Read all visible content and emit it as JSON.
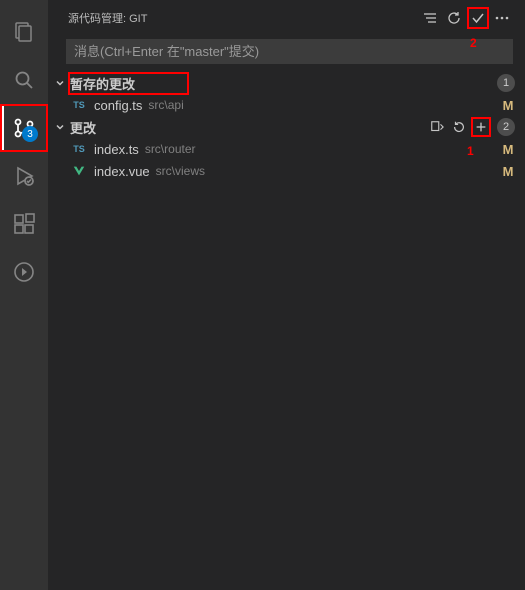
{
  "activityBar": {
    "scmBadge": "3"
  },
  "panel": {
    "title": "源代码管理: GIT",
    "messagePlaceholder": "消息(Ctrl+Enter 在\"master\"提交)"
  },
  "staged": {
    "title": "暂存的更改",
    "count": "1",
    "files": [
      {
        "icon": "TS",
        "name": "config.ts",
        "path": "src\\api",
        "status": "M"
      }
    ]
  },
  "changes": {
    "title": "更改",
    "count": "2",
    "files": [
      {
        "icon": "TS",
        "name": "index.ts",
        "path": "src\\router",
        "status": "M"
      },
      {
        "icon": "VUE",
        "name": "index.vue",
        "path": "src\\views",
        "status": "M"
      }
    ]
  },
  "annotations": {
    "a1": "1",
    "a2": "2"
  }
}
